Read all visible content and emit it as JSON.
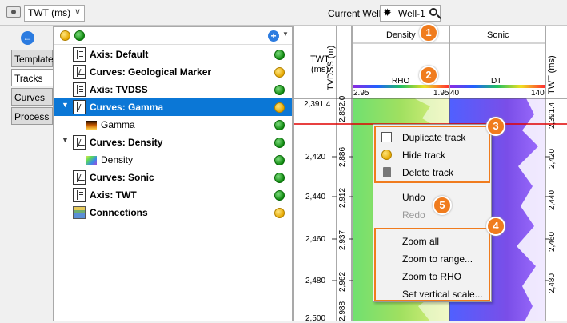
{
  "toolbar": {
    "unit_value": "TWT (ms)",
    "current_well_label": "Current Well",
    "well_value": "Well-1",
    "camera_icon": "camera-icon",
    "search_icon": "search-icon"
  },
  "side_tabs": [
    {
      "label": "Template"
    },
    {
      "label": "Tracks"
    },
    {
      "label": "Curves"
    },
    {
      "label": "Process"
    }
  ],
  "tree": {
    "items": [
      {
        "label": "Axis: Default",
        "status": "green"
      },
      {
        "label": "Curves: Geological Marker",
        "status": "yellow"
      },
      {
        "label": "Axis: TVDSS",
        "status": "green"
      },
      {
        "label": "Curves: Gamma",
        "status": "yellow"
      },
      {
        "label": "Gamma",
        "status": "green"
      },
      {
        "label": "Curves: Density",
        "status": "green"
      },
      {
        "label": "Density",
        "status": "green"
      },
      {
        "label": "Curves: Sonic",
        "status": "green"
      },
      {
        "label": "Axis: TWT",
        "status": "green"
      },
      {
        "label": "Connections",
        "status": "yellow"
      }
    ]
  },
  "log": {
    "twt_header": "TWT\n(ms)",
    "tvdss_header": "TVDSS (m)",
    "twt_right_header": "TWT (ms)",
    "track_density": "Density",
    "track_sonic": "Sonic",
    "rho_label": "RHO",
    "dt_label": "DT",
    "rho_min": "2.95",
    "rho_max": "1.95",
    "dt_min": "40",
    "dt_max": "140",
    "twt_ticks": [
      "2,391.4",
      "2,420",
      "2,440",
      "2,460",
      "2,480",
      "2,500"
    ],
    "tvdss_ticks": [
      "2,852.0",
      "2,886",
      "2,912",
      "2,937",
      "2,962",
      "2,988"
    ],
    "twt_right_ticks": [
      "2,391.4",
      "2,420",
      "2,440",
      "2,460",
      "2,480"
    ]
  },
  "context_menu": {
    "items": [
      {
        "label": "Duplicate track"
      },
      {
        "label": "Hide track"
      },
      {
        "label": "Delete track"
      },
      {
        "label": "Undo"
      },
      {
        "label": "Redo"
      },
      {
        "label": "Zoom all"
      },
      {
        "label": "Zoom to range..."
      },
      {
        "label": "Zoom to RHO"
      },
      {
        "label": "Set vertical scale..."
      }
    ]
  },
  "badges": [
    "1",
    "2",
    "3",
    "4",
    "5"
  ],
  "colors": {
    "accent": "#f07c1e",
    "selection": "#0b77d6",
    "marker_line": "#e00000"
  }
}
